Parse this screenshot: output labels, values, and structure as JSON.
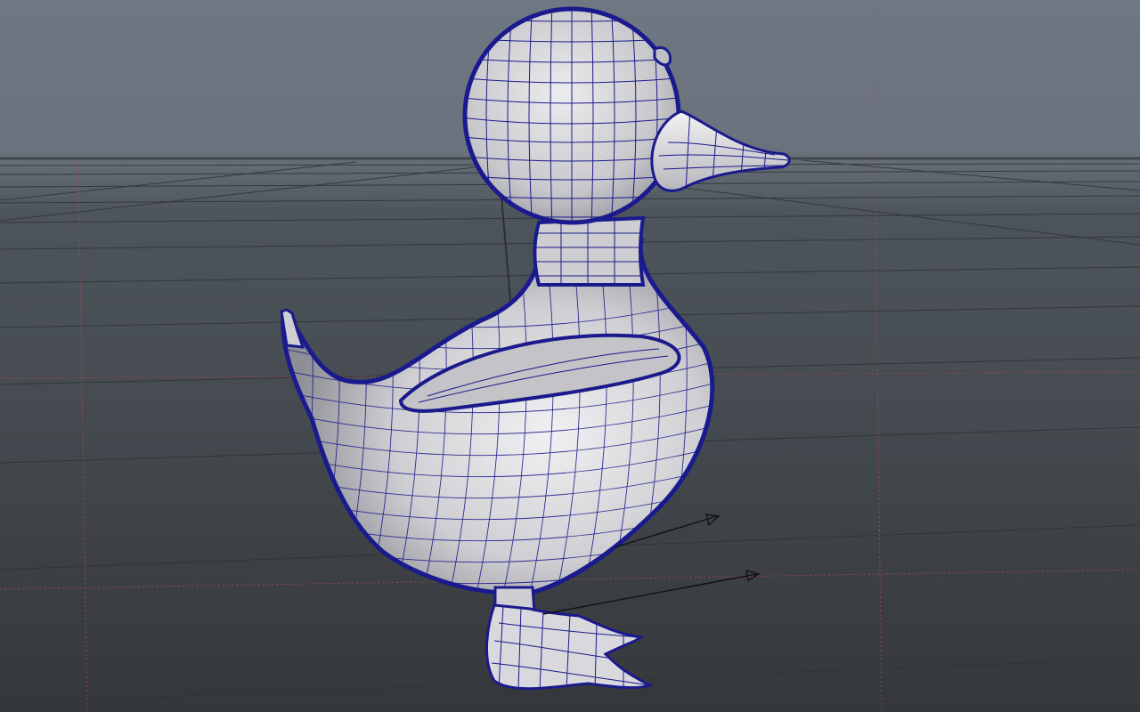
{
  "viewport": {
    "background_top": "#6e7782",
    "background_bottom": "#35383b",
    "grid_color": "#2f3337",
    "axis_line_color": "#b04a4a"
  },
  "model": {
    "object": "duck",
    "display_mode": "wireframe-on-shaded",
    "wire_color": "#1a1a8c",
    "surface_color": "#d3d3d6",
    "parts": [
      "head-icon",
      "beak-icon",
      "eye-icon",
      "neck-icon",
      "body-icon",
      "wing-icon",
      "tail-icon",
      "leg-icon",
      "foot-icon"
    ]
  },
  "locators": {
    "icon": "arrow-icon",
    "color": "#111111",
    "count": 2
  }
}
